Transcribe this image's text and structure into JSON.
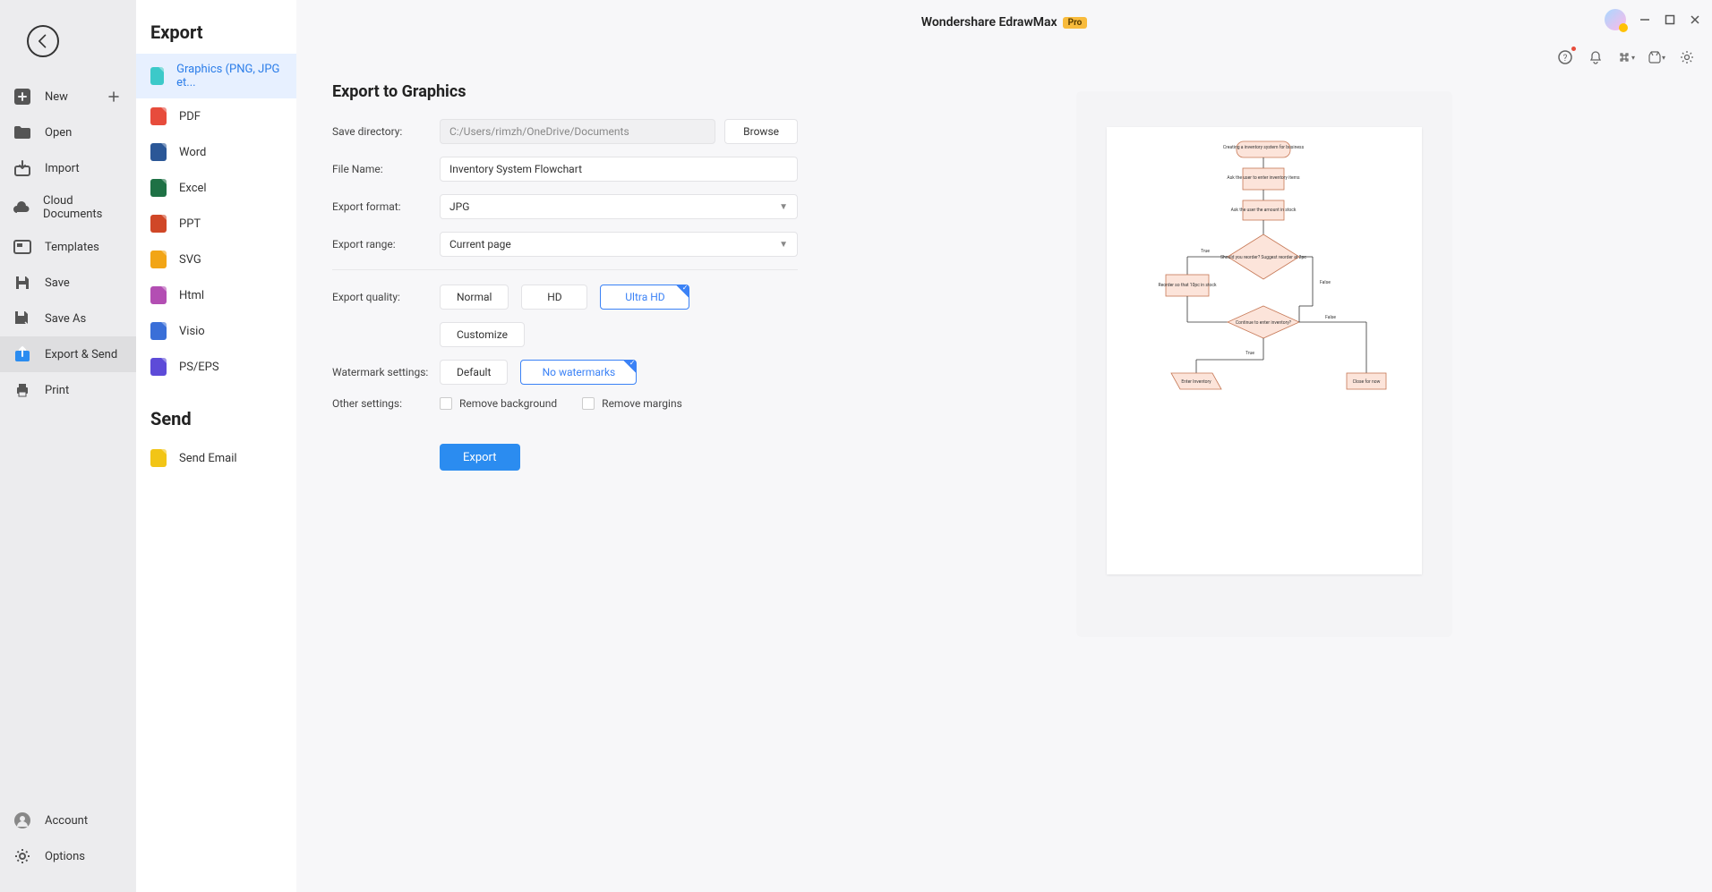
{
  "app": {
    "title": "Wondershare EdrawMax",
    "badge": "Pro"
  },
  "leftMenu": {
    "new": "New",
    "open": "Open",
    "import": "Import",
    "cloud": "Cloud Documents",
    "templates": "Templates",
    "save": "Save",
    "saveAs": "Save As",
    "exportSend": "Export & Send",
    "print": "Print",
    "account": "Account",
    "options": "Options"
  },
  "mid": {
    "exportHeading": "Export",
    "sendHeading": "Send",
    "items": {
      "graphics": "Graphics (PNG, JPG et...",
      "pdf": "PDF",
      "word": "Word",
      "excel": "Excel",
      "ppt": "PPT",
      "svg": "SVG",
      "html": "Html",
      "visio": "Visio",
      "pseps": "PS/EPS",
      "email": "Send Email"
    }
  },
  "form": {
    "title": "Export to Graphics",
    "labels": {
      "saveDir": "Save directory:",
      "fileName": "File Name:",
      "format": "Export format:",
      "range": "Export range:",
      "quality": "Export quality:",
      "watermark": "Watermark settings:",
      "other": "Other settings:"
    },
    "values": {
      "saveDir": "C:/Users/rimzh/OneDrive/Documents",
      "fileName": "Inventory System Flowchart",
      "format": "JPG",
      "range": "Current page"
    },
    "quality": {
      "normal": "Normal",
      "hd": "HD",
      "ultra": "Ultra HD",
      "customize": "Customize"
    },
    "watermark": {
      "default": "Default",
      "none": "No watermarks"
    },
    "other": {
      "removeBg": "Remove background",
      "removeMargins": "Remove margins"
    },
    "browse": "Browse",
    "export": "Export"
  },
  "flowchart": {
    "n1": "Creating a inventory system for business",
    "n2": "Ask the user to enter inventory items",
    "n3": "Ask the user the amount in stock",
    "n4": "Should you reorder? Suggest reorder at 2pc",
    "n5": "Reorder so that 10pc in stock",
    "n6": "Continue to enter inventory?",
    "n7": "Enter Inventory",
    "n8": "Close for now",
    "edgeTrue": "True",
    "edgeFalse": "False"
  }
}
